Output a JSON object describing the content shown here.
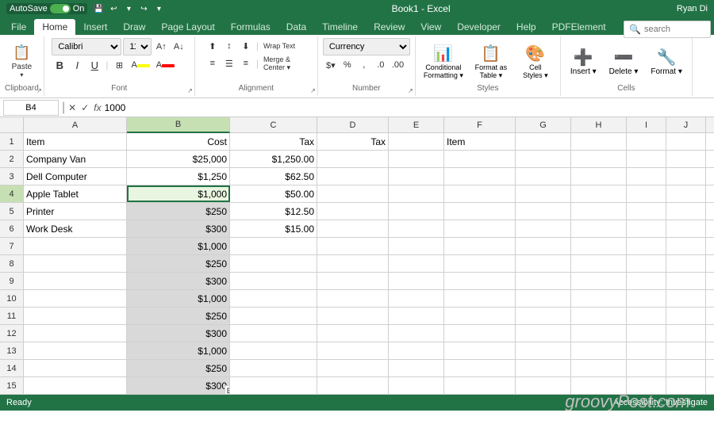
{
  "titlebar": {
    "autosave_label": "AutoSave",
    "autosave_state": "On",
    "title": "Book1 - Excel",
    "user": "Ryan Di"
  },
  "quickaccess": {
    "save_label": "Save",
    "undo_label": "Undo",
    "redo_label": "Redo"
  },
  "ribbon": {
    "tabs": [
      "File",
      "Home",
      "Insert",
      "Draw",
      "Page Layout",
      "Formulas",
      "Data",
      "Timeline",
      "Review",
      "View",
      "Developer",
      "Help",
      "PDFElement"
    ],
    "active_tab": "Home",
    "groups": {
      "clipboard": {
        "label": "Clipboard",
        "paste": "Paste"
      },
      "font": {
        "label": "Font",
        "font_name": "Calibri",
        "font_size": "11",
        "bold": "B",
        "italic": "I",
        "underline": "U"
      },
      "alignment": {
        "label": "Alignment",
        "wrap_text": "Wrap Text",
        "merge_center": "Merge & Center"
      },
      "number": {
        "label": "Number",
        "format": "Currency"
      },
      "styles": {
        "label": "Styles",
        "conditional": "Conditional Formatting",
        "format_table": "Format as Table",
        "cell_styles": "Cell Styles"
      },
      "cells": {
        "label": "Cells",
        "insert": "Insert",
        "delete": "Delete",
        "format": "Format"
      }
    }
  },
  "search": {
    "placeholder": "search",
    "value": ""
  },
  "formulabar": {
    "cell_ref": "B4",
    "formula": "1000"
  },
  "columns": [
    "A",
    "B",
    "C",
    "D",
    "E",
    "F",
    "G",
    "H",
    "I",
    "J"
  ],
  "rows": [
    {
      "num": 1,
      "a": "Item",
      "b": "Cost",
      "c": "Tax",
      "d": "Tax",
      "e": "",
      "f": "Item",
      "g": "",
      "h": "",
      "i": "",
      "j": ""
    },
    {
      "num": 2,
      "a": "Company Van",
      "b": "$25,000",
      "c": "$1,250.00",
      "d": "",
      "e": "",
      "f": "",
      "g": "",
      "h": "",
      "i": "",
      "j": ""
    },
    {
      "num": 3,
      "a": "Dell Computer",
      "b": "$1,250",
      "c": "$62.50",
      "d": "",
      "e": "",
      "f": "",
      "g": "",
      "h": "",
      "i": "",
      "j": ""
    },
    {
      "num": 4,
      "a": "Apple Tablet",
      "b": "$1,000",
      "c": "$50.00",
      "d": "",
      "e": "",
      "f": "",
      "g": "",
      "h": "",
      "i": "",
      "j": ""
    },
    {
      "num": 5,
      "a": "Printer",
      "b": "$250",
      "c": "$12.50",
      "d": "",
      "e": "",
      "f": "",
      "g": "",
      "h": "",
      "i": "",
      "j": ""
    },
    {
      "num": 6,
      "a": "Work Desk",
      "b": "$300",
      "c": "$15.00",
      "d": "",
      "e": "",
      "f": "",
      "g": "",
      "h": "",
      "i": "",
      "j": ""
    },
    {
      "num": 7,
      "a": "",
      "b": "$1,000",
      "c": "",
      "d": "",
      "e": "",
      "f": "",
      "g": "",
      "h": "",
      "i": "",
      "j": ""
    },
    {
      "num": 8,
      "a": "",
      "b": "$250",
      "c": "",
      "d": "",
      "e": "",
      "f": "",
      "g": "",
      "h": "",
      "i": "",
      "j": ""
    },
    {
      "num": 9,
      "a": "",
      "b": "$300",
      "c": "",
      "d": "",
      "e": "",
      "f": "",
      "g": "",
      "h": "",
      "i": "",
      "j": ""
    },
    {
      "num": 10,
      "a": "",
      "b": "$1,000",
      "c": "",
      "d": "",
      "e": "",
      "f": "",
      "g": "",
      "h": "",
      "i": "",
      "j": ""
    },
    {
      "num": 11,
      "a": "",
      "b": "$250",
      "c": "",
      "d": "",
      "e": "",
      "f": "",
      "g": "",
      "h": "",
      "i": "",
      "j": ""
    },
    {
      "num": 12,
      "a": "",
      "b": "$300",
      "c": "",
      "d": "",
      "e": "",
      "f": "",
      "g": "",
      "h": "",
      "i": "",
      "j": ""
    },
    {
      "num": 13,
      "a": "",
      "b": "$1,000",
      "c": "",
      "d": "",
      "e": "",
      "f": "",
      "g": "",
      "h": "",
      "i": "",
      "j": ""
    },
    {
      "num": 14,
      "a": "",
      "b": "$250",
      "c": "",
      "d": "",
      "e": "",
      "f": "",
      "g": "",
      "h": "",
      "i": "",
      "j": ""
    },
    {
      "num": 15,
      "a": "",
      "b": "$300",
      "c": "",
      "d": "",
      "e": "",
      "f": "",
      "g": "",
      "h": "",
      "i": "",
      "j": ""
    }
  ],
  "watermark": "groovyPost.com",
  "statusbar": {
    "ready": "Ready",
    "accessibility": "Accessibility: Investigate"
  }
}
